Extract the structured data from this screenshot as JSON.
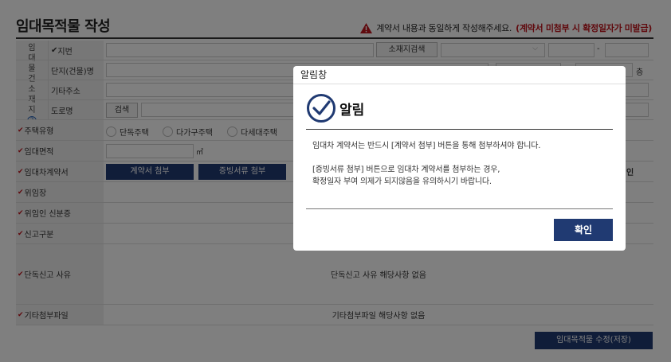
{
  "page": {
    "title": "임대목적물 작성",
    "notice_text": "계약서 내용과 동일하게 작성해주세요.",
    "notice_red": "(계약서 미첨부 시 확정일자가 미발급)"
  },
  "form": {
    "group_vertical_label": [
      "임",
      "대",
      "물",
      "건",
      "소",
      "재",
      "지"
    ],
    "address": {
      "lot_label": "지번",
      "address_search_button": "소재지검색",
      "dash": "-",
      "complex_label": "단지(건물)명",
      "floor_unit": "층",
      "other_address_label": "기타주소",
      "road_label": "도로명",
      "search_button": "검색"
    },
    "housing_type": {
      "label": "주택유형",
      "options": [
        "단독주택",
        "다가구주택",
        "다세대주택"
      ]
    },
    "area": {
      "label": "임대면적",
      "unit": "㎡"
    },
    "contract": {
      "label": "임대차계약서",
      "attach_contract_button": "계약서 첨부",
      "attach_evidence_button": "증빙서류 첨부",
      "right_fragment": "인"
    },
    "power_of_attorney": {
      "label": "위임장"
    },
    "delegate_id": {
      "label": "위임인 신분증"
    },
    "report_type": {
      "label": "신고구분"
    },
    "sole_report_reason": {
      "label": "단독신고 사유",
      "value": "단독신고 사유 해당사항 없음"
    },
    "other_attachment": {
      "label": "기타첨부파일",
      "value": "기타첨부파일 해당사항 없음"
    },
    "save_button": "임대목적물 수정(저장)"
  },
  "modal": {
    "header": "알림창",
    "title": "알림",
    "message_line1": "임대차 계약서는 반드시 [계약서 첨부] 버튼을 통해 첨부하셔야 합니다.",
    "message_line2": "[증빙서류 첨부] 버튼으로 임대차 계약서를 첨부하는 경우,",
    "message_line3": "확정일자 부여 의제가 되지않음을 유의하시기 바랍니다.",
    "ok_button": "확인"
  },
  "colors": {
    "navy_button": "#203a72",
    "accent_red": "#c0151d",
    "label_bg": "#eeeeee",
    "overlay": "rgba(0,0,0,0.5)"
  },
  "icons": [
    "warning-icon",
    "help-icon",
    "check-circle-icon",
    "chevron-down-icon"
  ]
}
